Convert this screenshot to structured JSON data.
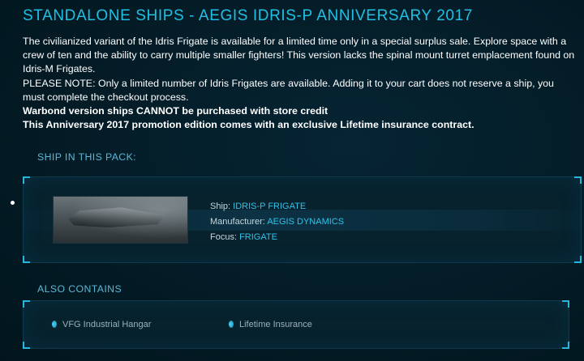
{
  "page_title": "STANDALONE SHIPS - AEGIS IDRIS-P ANNIVERSARY 2017",
  "description": {
    "paragraph_1": "The civilianized variant of the Idris Frigate is available for a limited time only in a special surplus sale. Explore space with a crew of ten and the ability to carry multiple smaller fighters! This version lacks the spinal mount turret emplacement found on Idris-M Frigates.",
    "note": "PLEASE NOTE: Only a limited number of Idris Frigates are available. Adding it to your cart does not reserve a ship, you must complete the checkout process.",
    "warbond_notice": "Warbond version ships CANNOT be purchased with store credit",
    "insurance_notice": "This Anniversary 2017 promotion edition comes with an exclusive Lifetime insurance contract."
  },
  "ship_section": {
    "heading": "SHIP IN THIS PACK:",
    "ship": {
      "ship_label": "Ship:",
      "ship_value": "IDRIS-P FRIGATE",
      "manufacturer_label": "Manufacturer:",
      "manufacturer_value": "AEGIS DYNAMICS",
      "focus_label": "Focus:",
      "focus_value": "FRIGATE"
    }
  },
  "also_contains": {
    "heading": "ALSO CONTAINS",
    "items": [
      "VFG Industrial Hangar",
      "Lifetime Insurance"
    ]
  },
  "colors": {
    "accent": "#1fc0e4",
    "background": "#031a24",
    "panel": "#07212d",
    "label": "#59b7d6"
  },
  "icons": {
    "list_bullet": "dot-bullet-icon",
    "item_marker": "item-marker-icon"
  }
}
